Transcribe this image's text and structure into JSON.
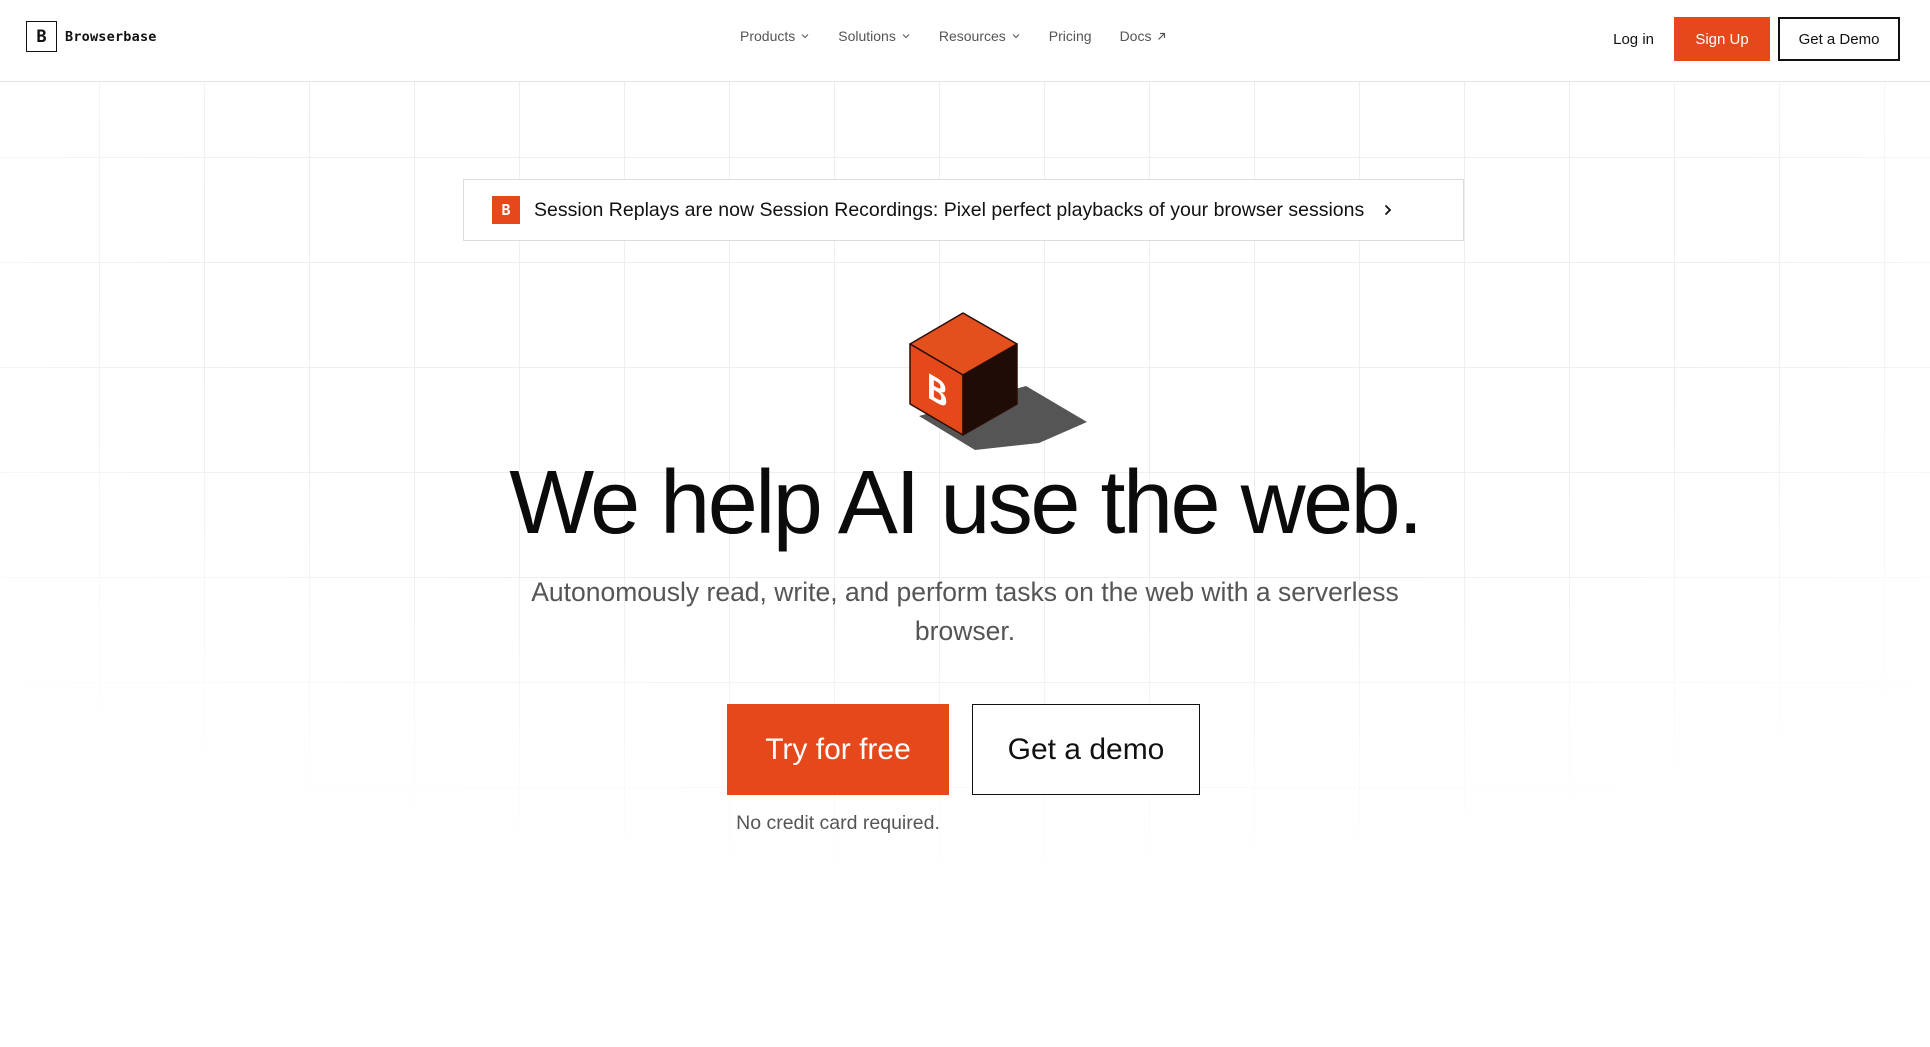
{
  "brand": {
    "logo_letter": "B",
    "name": "Browserbase"
  },
  "nav": {
    "items": [
      {
        "label": "Products",
        "icon": "chevron-down-icon"
      },
      {
        "label": "Solutions",
        "icon": "chevron-down-icon"
      },
      {
        "label": "Resources",
        "icon": "chevron-down-icon"
      },
      {
        "label": "Pricing"
      },
      {
        "label": "Docs",
        "icon": "arrow-up-right-icon"
      }
    ],
    "login": "Log in",
    "signup": "Sign Up",
    "demo": "Get a Demo"
  },
  "announcement": {
    "badge": "B",
    "text": "Session Replays are now Session Recordings: Pixel perfect playbacks of your browser sessions",
    "icon": "chevron-right-icon"
  },
  "hero": {
    "cube_letter": "B",
    "title": "We help AI use the web.",
    "subtitle": "Autonomously read, write, and perform tasks on the web with a serverless browser.",
    "cta_primary": "Try for free",
    "cta_secondary": "Get a demo",
    "note": "No credit card required."
  },
  "colors": {
    "accent": "#e5481b",
    "text": "#111111",
    "muted": "#555555",
    "border": "#dcdcdc"
  }
}
